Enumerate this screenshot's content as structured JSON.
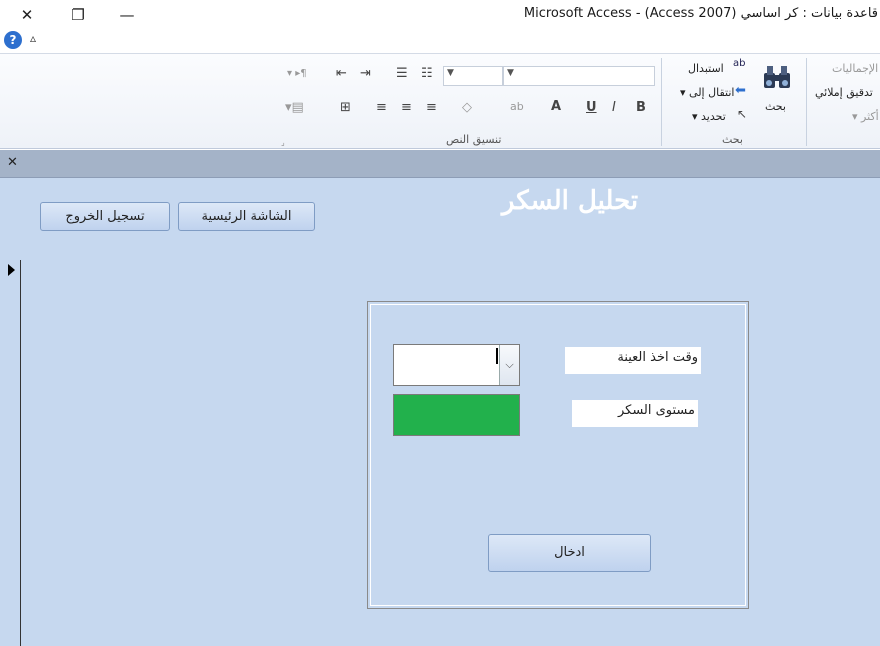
{
  "window": {
    "title": "Microsoft Access - (Access 2007) قاعدة بيانات : كر اساسي",
    "close_glyph": "✕",
    "restore_glyph": "❐",
    "minimize_glyph": "—"
  },
  "quick": {
    "help_glyph": "?",
    "collapse_glyph": "▵"
  },
  "ribbon": {
    "text_format_group_label": "تنسيق النص",
    "find_group_label": "بحث",
    "find_button": "بحث",
    "replace_label": "استبدال",
    "goto_label": "انتقال إلى",
    "select_label": "تحديد",
    "totals_label": "الإجماليات",
    "spelling_label": "تدقيق إملائي",
    "more_label": "أكثر",
    "format_buttons": {
      "bold": "B",
      "italic": "I",
      "underline": "U",
      "font_color": "A",
      "highlight": "ab",
      "fill": "◇"
    },
    "launcher_glyph": "⌟"
  },
  "doc": {
    "close_glyph": "✕"
  },
  "form": {
    "title": "تحليل السكر",
    "home_button": "الشاشة الرئيسية",
    "logout_button": "تسجيل الخروج",
    "sample_time_label": "وقت اخذ العينة",
    "sugar_level_label": "مستوى السكر",
    "sample_time_value": "",
    "enter_button": "ادخال",
    "level_color": "#22b14c",
    "dropdown_glyph": "⌵"
  }
}
